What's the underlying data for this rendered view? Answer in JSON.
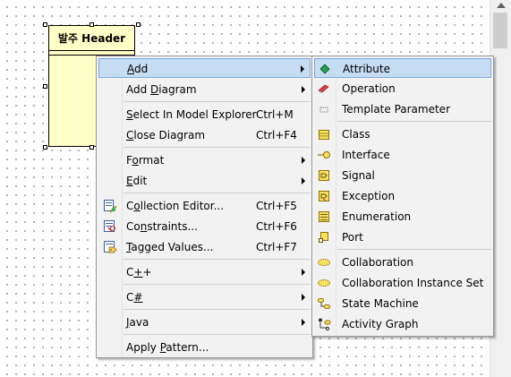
{
  "class_box": {
    "title": "발주 Header"
  },
  "context_menu": {
    "items": [
      {
        "label": "Add",
        "mnemonic": "A",
        "submenu": true,
        "highlighted": true
      },
      {
        "label": "Add Diagram",
        "mnemonic": "D",
        "submenu": true
      },
      {
        "label": "Select In Model Explorer",
        "mnemonic": "S",
        "shortcut": "Ctrl+M"
      },
      {
        "label": "Close Diagram",
        "mnemonic": "C",
        "shortcut": "Ctrl+F4"
      },
      {
        "label": "Format",
        "mnemonic": "o",
        "submenu": true
      },
      {
        "label": "Edit",
        "mnemonic": "E",
        "submenu": true
      },
      {
        "label": "Collection Editor...",
        "mnemonic": "o",
        "shortcut": "Ctrl+F5",
        "icon": "collection-editor-icon"
      },
      {
        "label": "Constraints...",
        "mnemonic": "n",
        "shortcut": "Ctrl+F6",
        "icon": "constraints-icon"
      },
      {
        "label": "Tagged Values...",
        "mnemonic": "T",
        "shortcut": "Ctrl+F7",
        "icon": "tagged-values-icon"
      },
      {
        "label": "C++",
        "mnemonic": "+",
        "submenu": true
      },
      {
        "label": "C#",
        "mnemonic": "#",
        "submenu": true
      },
      {
        "label": "Java",
        "mnemonic": "J",
        "submenu": true
      },
      {
        "label": "Apply Pattern...",
        "mnemonic": "P"
      }
    ]
  },
  "add_submenu": {
    "items": [
      {
        "label": "Attribute",
        "icon": "attribute-icon",
        "highlighted": true
      },
      {
        "label": "Operation",
        "icon": "operation-icon"
      },
      {
        "label": "Template Parameter",
        "icon": "template-parameter-icon"
      },
      {
        "label": "Class",
        "icon": "class-icon"
      },
      {
        "label": "Interface",
        "icon": "interface-icon"
      },
      {
        "label": "Signal",
        "icon": "signal-icon"
      },
      {
        "label": "Exception",
        "icon": "exception-icon"
      },
      {
        "label": "Enumeration",
        "icon": "enumeration-icon"
      },
      {
        "label": "Port",
        "icon": "port-icon"
      },
      {
        "label": "Collaboration",
        "icon": "collaboration-icon"
      },
      {
        "label": "Collaboration Instance Set",
        "icon": "collaboration-instance-set-icon"
      },
      {
        "label": "State Machine",
        "icon": "state-machine-icon"
      },
      {
        "label": "Activity Graph",
        "icon": "activity-graph-icon"
      }
    ]
  },
  "colors": {
    "highlight_bg": "#c6dcf3",
    "highlight_border": "#7ea9da",
    "class_fill": "#ffffc8",
    "menu_bg": "#f2f2f2"
  }
}
